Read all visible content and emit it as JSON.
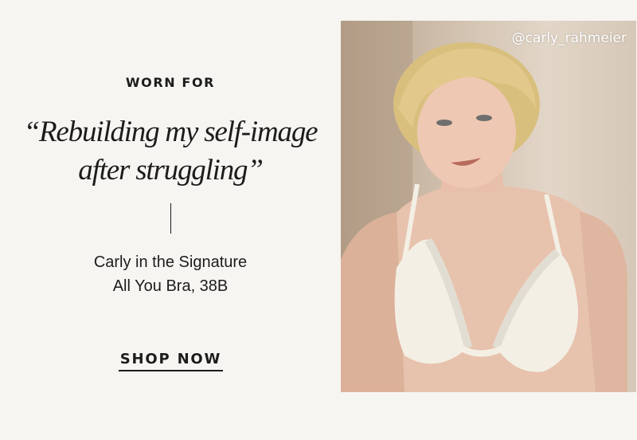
{
  "promo": {
    "eyebrow": "WORN FOR",
    "quote_line1": "“Rebuilding my self-image",
    "quote_line2": "after struggling”",
    "caption_line1": "Carly in the Signature",
    "caption_line2": "All You Bra, 38B",
    "cta_label": "SHOP NOW"
  },
  "photo": {
    "handle": "@carly_rahmeier"
  },
  "colors": {
    "background": "#f7f5f1",
    "text": "#1c1c1c",
    "bra": "#f3efe4"
  }
}
